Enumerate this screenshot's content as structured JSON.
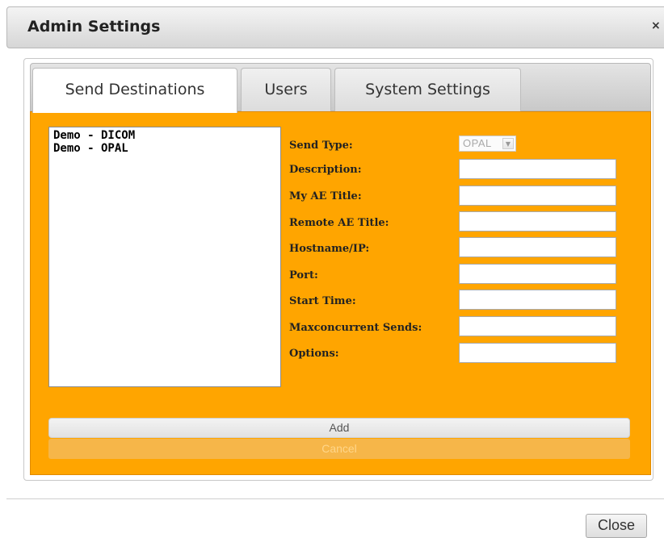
{
  "dialog": {
    "title": "Admin Settings",
    "close_symbol": "×",
    "close_button_label": "Close"
  },
  "tabs": [
    {
      "label": "Send Destinations",
      "active": true
    },
    {
      "label": "Users",
      "active": false
    },
    {
      "label": "System Settings",
      "active": false
    }
  ],
  "destinations": [
    "Demo - DICOM",
    "Demo - OPAL"
  ],
  "form": {
    "send_type_label": "Send Type:",
    "send_type_value": "OPAL",
    "fields": [
      {
        "label": "Description:",
        "value": ""
      },
      {
        "label": "My AE Title:",
        "value": ""
      },
      {
        "label": "Remote AE Title:",
        "value": ""
      },
      {
        "label": "Hostname/IP:",
        "value": ""
      },
      {
        "label": "Port:",
        "value": ""
      },
      {
        "label": "Start Time:",
        "value": ""
      },
      {
        "label": "Maxconcurrent Sends:",
        "value": ""
      },
      {
        "label": "Options:",
        "value": ""
      }
    ]
  },
  "buttons": {
    "add": "Add",
    "cancel": "Cancel"
  },
  "colors": {
    "panel_background": "#ffa500",
    "cancel_disabled": "#f6b649"
  },
  "icons": {
    "close": "close-icon",
    "dropdown": "chevron-down-icon"
  }
}
